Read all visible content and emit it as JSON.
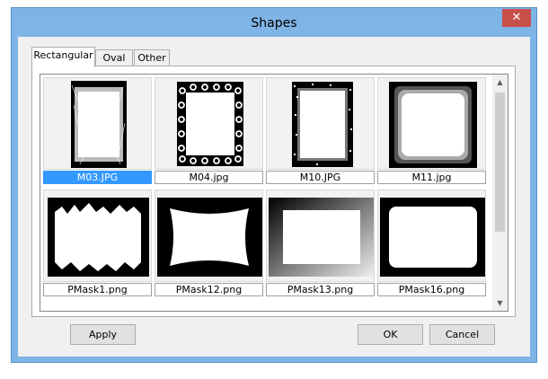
{
  "window": {
    "title": "Shapes",
    "close_glyph": "✕"
  },
  "tabs": [
    {
      "label": "Rectangular",
      "active": true
    },
    {
      "label": "Oval",
      "active": false
    },
    {
      "label": "Other",
      "active": false
    }
  ],
  "shapes": [
    {
      "name": "M03.JPG",
      "selected": true
    },
    {
      "name": "M04.jpg",
      "selected": false
    },
    {
      "name": "M10.JPG",
      "selected": false
    },
    {
      "name": "M11.jpg",
      "selected": false
    },
    {
      "name": "PMask1.png",
      "selected": false
    },
    {
      "name": "PMask12.png",
      "selected": false
    },
    {
      "name": "PMask13.png",
      "selected": false
    },
    {
      "name": "PMask16.png",
      "selected": false
    }
  ],
  "scrollbar": {
    "up_glyph": "▲",
    "down_glyph": "▼"
  },
  "buttons": {
    "apply": "Apply",
    "ok": "OK",
    "cancel": "Cancel"
  },
  "colors": {
    "selection": "#3399ff",
    "title_bar": "#7fb4e6",
    "close_button": "#c7504b"
  }
}
